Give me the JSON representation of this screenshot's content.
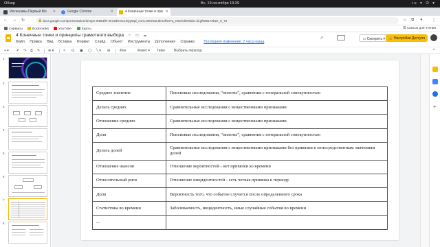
{
  "os_topbar": {
    "left": "Обзор",
    "clock": "Вс, 19 сентября  19:39",
    "right": "ru ▾ ⏻ ▾"
  },
  "browser": {
    "tabs": [
      {
        "label": "Интенсивы Первый Мо",
        "favicon_color": "#3c4043",
        "active": false
      },
      {
        "label": "Google Chrome",
        "favicon_color": "#4285f4",
        "active": false
      },
      {
        "label": "4 Конечные точки и при",
        "favicon_color": "#f4b400",
        "active": true
      }
    ],
    "new_tab": "+",
    "window_controls": "— ▢ ✕",
    "url": "docs.google.com/presentation/d/1Qm-0t0B1fR-Dm4dKGC1kQy9qd_coALzWX0wL9kXzfNnFq_KEt/edit#slide=id.gf098172b2e_0_70",
    "bookmarks": [
      {
        "label": "Сервисы",
        "icon": "grid-icon",
        "color": "#5f6368"
      },
      {
        "label": "Bookmarks",
        "icon": "folder-icon",
        "color": "#f4b400"
      },
      {
        "label": "YouTube",
        "icon": "youtube-icon",
        "color": "#ff0000"
      },
      {
        "label": "Карты",
        "icon": "maps-icon",
        "color": "#34a853"
      }
    ],
    "reading_list": "Список для чтения"
  },
  "doc": {
    "title": "4 Конечные точки и принципы грамотного выбора",
    "menus": [
      "Файл",
      "Правка",
      "Вид",
      "Вставка",
      "Формат",
      "Слайд",
      "Объект",
      "Инструменты",
      "Дополнения",
      "Справка"
    ],
    "last_edit": "Последнее изменение: 2 часа назад",
    "present_label": "Смотреть",
    "access_label": "🔒 Настройки Доступа"
  },
  "toolbar": {
    "fon": "Фон",
    "maket": "Макет ▾",
    "tema": "Тема",
    "perehod": "Выбрать переход"
  },
  "filmstrip": {
    "numbers": [
      "1",
      "2",
      "3",
      "4",
      "5",
      "6",
      "7",
      "8"
    ],
    "selected_index": 7
  },
  "table": {
    "rows": [
      [
        "Среднее значение",
        "Поисковые исследования, “пилоты”, сравнения с генеральной совокупностью"
      ],
      [
        "Дельта средних",
        "Сравнительные исследования с вещественными признаками"
      ],
      [
        "Отношение средних",
        "Сравнительные исследования с вещественными признаками"
      ],
      [
        "Доля",
        "Поисковые исследования, “пилоты”, сравнения с генеральной совокупностью"
      ],
      [
        "Дельта долей",
        "Сравнительные исследования с вещественными признаками без привязки к непосредственным значениям долей"
      ],
      [
        "Отношение шансов",
        "Отношение вероятностей - нет привязки ко времени"
      ],
      [
        "Относительный риск",
        "Отношение инцидентностей - есть четкая привязка к периоду"
      ],
      [
        "Доля",
        "Вероятность того, что событие случится после определенного срока"
      ],
      [
        "Статистика во времени",
        "Заболеваемость, инцидентность, иные случайные события во времени"
      ],
      [
        "...",
        ""
      ]
    ]
  }
}
